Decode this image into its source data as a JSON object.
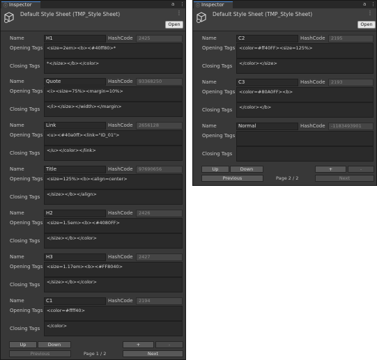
{
  "panels": [
    {
      "tab_label": "Inspector",
      "title": "Default Style Sheet (TMP_Style Sheet)",
      "open_label": "Open",
      "labels": {
        "name": "Name",
        "hashcode": "HashCode",
        "opening": "Opening Tags",
        "closing": "Closing Tags"
      },
      "entries": [
        {
          "name": "H1",
          "hashcode": "2425",
          "opening": "<size=2em><b><#40ff80>*",
          "closing": "*</size></b></color>"
        },
        {
          "name": "Quote",
          "hashcode": "93368250",
          "opening": "<i><size=75%><margin=10%>",
          "closing": "</i></size></width></margin>"
        },
        {
          "name": "Link",
          "hashcode": "2656128",
          "opening": "<u><#40a0ff><link=\"ID_01\">",
          "closing": "</u></color></link>"
        },
        {
          "name": "Title",
          "hashcode": "97690656",
          "opening": "<size=125%><b><align=center>",
          "closing": "</size></b></align>"
        },
        {
          "name": "H2",
          "hashcode": "2426",
          "opening": "<size=1.5em><b><#4080FF>",
          "closing": "</size></b></color>"
        },
        {
          "name": "H3",
          "hashcode": "2427",
          "opening": "<size=1.17em><b><#FF8040>",
          "closing": "</size></b></color>"
        },
        {
          "name": "C1",
          "hashcode": "2194",
          "opening": "<color=#ffff40>",
          "closing": "</color>"
        }
      ],
      "footer": {
        "up": "Up",
        "down": "Down",
        "add": "+",
        "remove": "-",
        "previous": "Previous",
        "page": "Page 1 / 2",
        "next": "Next"
      }
    },
    {
      "tab_label": "Inspector",
      "title": "Default Style Sheet (TMP_Style Sheet)",
      "open_label": "Open",
      "labels": {
        "name": "Name",
        "hashcode": "HashCode",
        "opening": "Opening Tags",
        "closing": "Closing Tags"
      },
      "entries": [
        {
          "name": "C2",
          "hashcode": "2195",
          "opening": "<color=#ff40FF><size=125%>",
          "closing": "</color></size>"
        },
        {
          "name": "C3",
          "hashcode": "2193",
          "opening": "<color=#80A0FF><b>",
          "closing": "</color></b>"
        },
        {
          "name": "Normal",
          "hashcode": "-1183493901",
          "opening": "",
          "closing": ""
        }
      ],
      "footer": {
        "up": "Up",
        "down": "Down",
        "add": "+",
        "remove": "-",
        "previous": "Previous",
        "page": "Page 2 / 2",
        "next": "Next"
      }
    }
  ]
}
